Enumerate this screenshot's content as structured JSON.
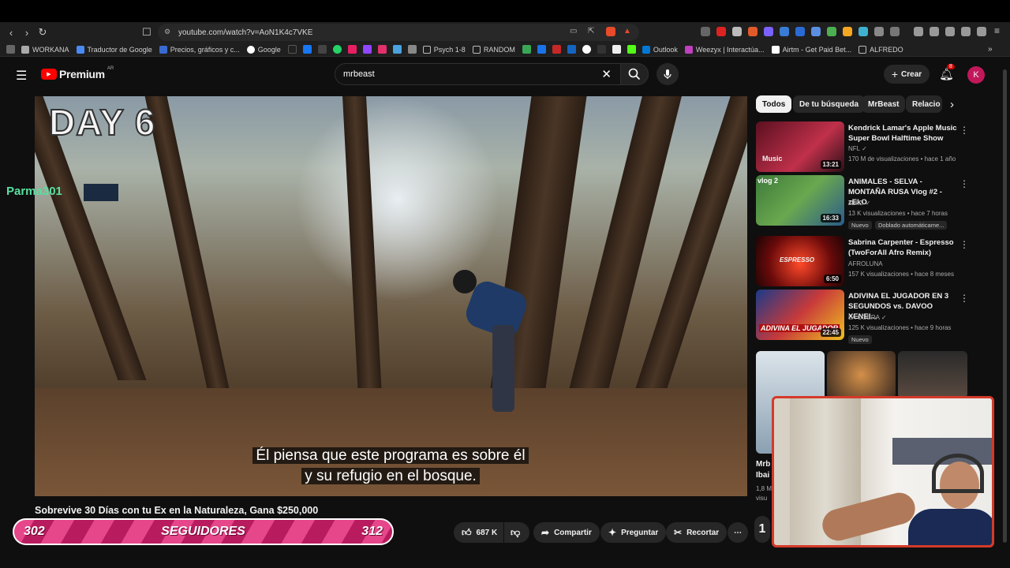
{
  "browser": {
    "url": "youtube.com/watch?v=AoN1K4c7VKE",
    "bookmarks": [
      "WORKANA",
      "Traductor de Google",
      "Precios, gráficos y c...",
      "Google",
      "Psych 1-8",
      "RANDOM",
      "Outlook",
      "Weezyx | Interactúa...",
      "Airtm - Get Paid Bet...",
      "ALFREDO"
    ]
  },
  "youtube": {
    "logo": "Premium",
    "region": "AR",
    "search_value": "mrbeast",
    "create_label": "Crear",
    "notif_count": "8",
    "avatar_letter": "K"
  },
  "video": {
    "overlay_title": "DAY 6",
    "chat_user": "Parma301",
    "subtitle_line1": "Él piensa que este programa es sobre él",
    "subtitle_line2": "y su refugio en el bosque.",
    "title": "Sobrevive 30 Días con tu Ex en la Naturaleza, Gana $250,000",
    "likes": "687 K",
    "share": "Compartir",
    "ask": "Preguntar",
    "clip": "Recortar"
  },
  "chips": [
    "Todos",
    "De tu búsqueda",
    "MrBeast",
    "Relacio"
  ],
  "recommendations": [
    {
      "title": "Kendrick Lamar's Apple Music Super Bowl Halftime Show",
      "channel": "NFL",
      "meta": "170 M de visualizaciones • hace 1 año",
      "duration": "13:21",
      "badge": ""
    },
    {
      "title": "ANIMALES - SELVA - MONTAÑA RUSA Vlog #2 - zEkO",
      "channel": "zEkO",
      "meta": "13 K visualizaciones • hace 7 horas",
      "duration": "16:33",
      "badge": "Nuevo",
      "badge2": "Doblado automáticame..."
    },
    {
      "title": "Sabrina Carpenter - Espresso (TwoForAll Afro Remix)",
      "channel": "AFROLUNA",
      "meta": "157 K visualizaciones • hace 8 meses",
      "duration": "6:50",
      "badge": ""
    },
    {
      "title": "ADIVINA EL JUGADOR EN 3 SEGUNDOS vs. DAVOO XENEI...",
      "channel": "LA COBRA",
      "meta": "125 K visualizaciones • hace 9 horas",
      "duration": "22:45",
      "badge": "Nuevo"
    }
  ],
  "partial_rec": {
    "title_a": "Mrb",
    "title_b": "Ibai",
    "meta_a": "1,8 M",
    "meta_b": "visu"
  },
  "followers": {
    "current": "302",
    "label": "SEGUIDORES",
    "goal": "312"
  },
  "side_partial_number": "1"
}
